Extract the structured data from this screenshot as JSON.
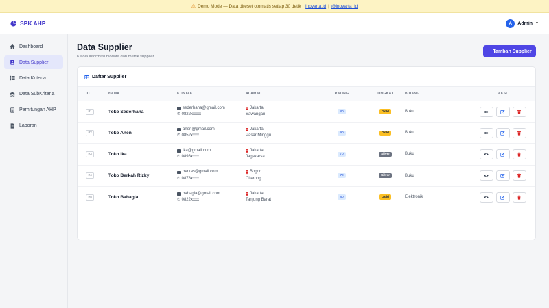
{
  "demo": {
    "text": "Demo Mode — Data direset otomatis setiap 30 detik |",
    "link1": "inovarta.id",
    "sep": "|",
    "link2": "@inovarta_id"
  },
  "brand": {
    "name": "SPK AHP"
  },
  "user": {
    "initial": "A",
    "name": "Admin"
  },
  "sidebar": {
    "items": [
      {
        "label": "Dashboard",
        "icon": "home-icon"
      },
      {
        "label": "Data Supplier",
        "icon": "user-tie-icon",
        "active": true
      },
      {
        "label": "Data Kriteria",
        "icon": "list-icon"
      },
      {
        "label": "Data SubKriteria",
        "icon": "layers-icon"
      },
      {
        "label": "Perhitungan AHP",
        "icon": "calculator-icon"
      },
      {
        "label": "Laporan",
        "icon": "file-icon"
      }
    ]
  },
  "page": {
    "title": "Data Supplier",
    "subtitle": "Kelola informasi biodata dan metrik supplier",
    "add_button": "Tambah Supplier"
  },
  "card": {
    "title": "Daftar Supplier"
  },
  "table": {
    "headers": {
      "id": "ID",
      "nama": "NAMA",
      "kontak": "KONTAK",
      "alamat": "ALAMAT",
      "rating": "RATING",
      "tingkat": "TINGKAT",
      "bidang": "BIDANG",
      "aksi": "AKSI"
    },
    "rows": [
      {
        "id": "#1",
        "nama": "Toko Sederhana",
        "email": "sederhana@gmail.com",
        "phone": "0822xxxxx",
        "kota": "Jakarta",
        "daerah": "Sawangan",
        "rating": "80",
        "tingkat": "Gold",
        "bidang": "Buku"
      },
      {
        "id": "#2",
        "nama": "Toko Anen",
        "email": "anen@gmail.com",
        "phone": "0852xxxx",
        "kota": "Jakarta",
        "daerah": "Pasar Minggu",
        "rating": "90",
        "tingkat": "Gold",
        "bidang": "Buku"
      },
      {
        "id": "#3",
        "nama": "Toko Ika",
        "email": "ika@gmail.com",
        "phone": "0898xxxx",
        "kota": "Jakarta",
        "daerah": "Jagakarsa",
        "rating": "70",
        "tingkat": "Silver",
        "bidang": "Buku"
      },
      {
        "id": "#4",
        "nama": "Toko Berkah Rizky",
        "email": "berkas@gmail.com",
        "phone": "0878xxxx",
        "kota": "Bogor",
        "daerah": "Citerong",
        "rating": "70",
        "tingkat": "Silver",
        "bidang": "Buku"
      },
      {
        "id": "#5",
        "nama": "Toko Bahagia",
        "email": "bahagia@gmail.com",
        "phone": "0822xxxx",
        "kota": "Jakarta",
        "daerah": "Tanjung Barat",
        "rating": "80",
        "tingkat": "Gold",
        "bidang": "Elektronik"
      }
    ]
  },
  "colors": {
    "primary": "#4f46e5",
    "brand": "#4338ca",
    "gold": "#fbbf24",
    "silver": "#6b7280",
    "delete": "#dc2626",
    "edit": "#2563eb"
  }
}
